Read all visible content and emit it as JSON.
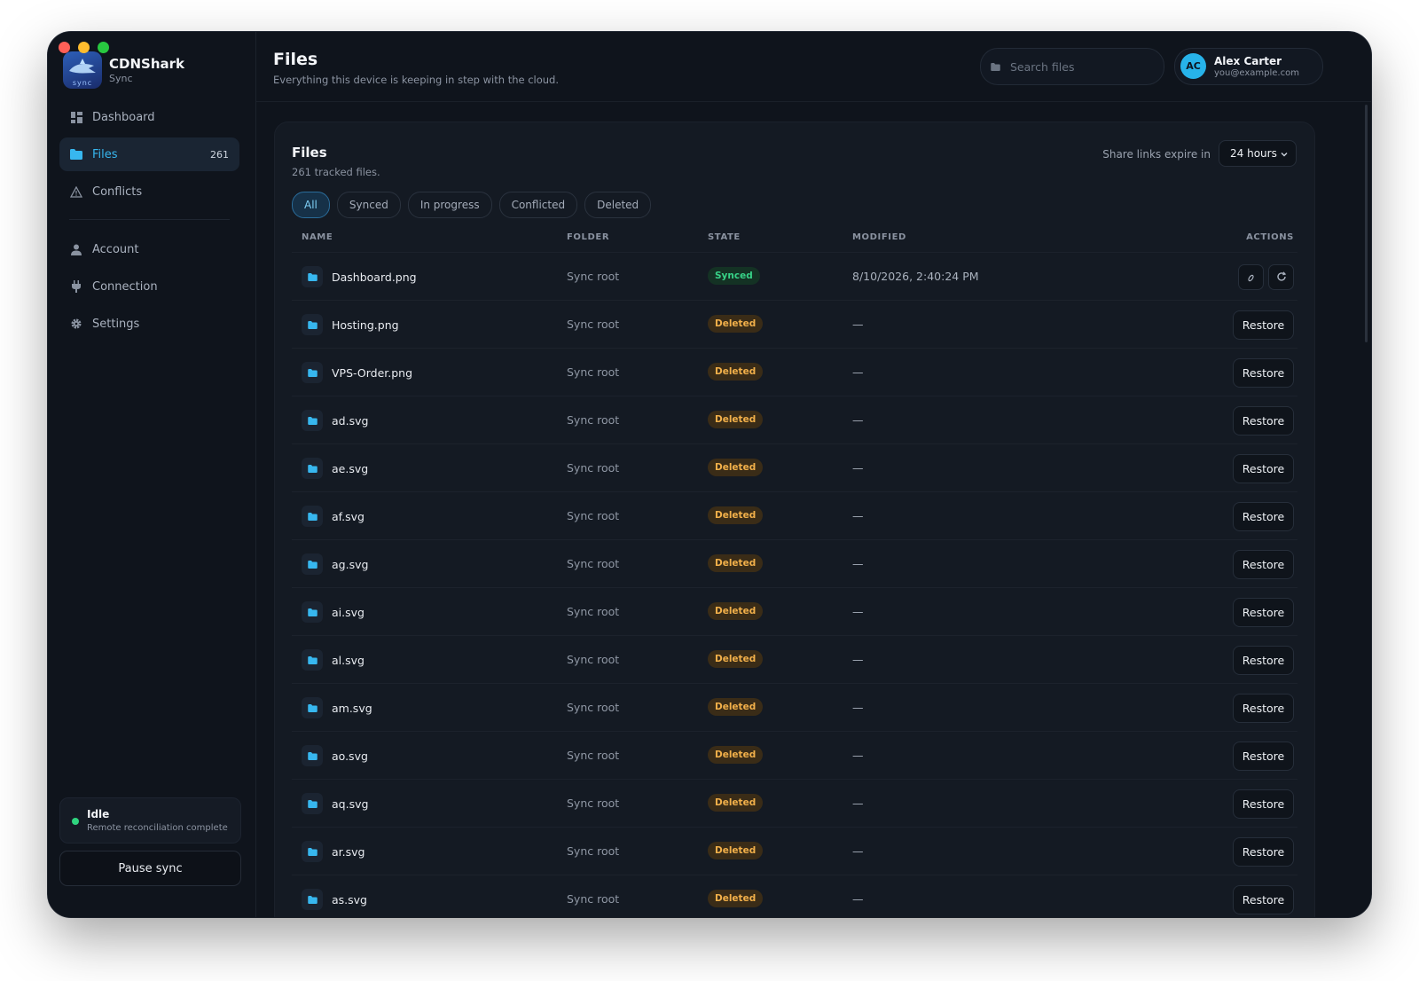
{
  "app": {
    "name": "CDNShark",
    "sub": "Sync",
    "logo_text": "sync"
  },
  "sidebar": {
    "items": [
      {
        "label": "Dashboard",
        "icon": "grid-icon"
      },
      {
        "label": "Files",
        "icon": "folder-icon",
        "count": "261",
        "active": true
      },
      {
        "label": "Conflicts",
        "icon": "warning-icon"
      },
      {
        "label": "Account",
        "icon": "user-icon"
      },
      {
        "label": "Connection",
        "icon": "plug-icon"
      },
      {
        "label": "Settings",
        "icon": "gear-icon"
      }
    ],
    "status": {
      "title": "Idle",
      "subtitle": "Remote reconciliation complete",
      "color": "#2fd47f"
    },
    "pause_label": "Pause sync"
  },
  "header": {
    "title": "Files",
    "subtitle": "Everything this device is keeping in step with the cloud.",
    "search_placeholder": "Search files",
    "user": {
      "initials": "AC",
      "name": "Alex Carter",
      "email": "you@example.com"
    }
  },
  "card": {
    "title": "Files",
    "subtitle": "261 tracked files.",
    "expire_label": "Share links expire in",
    "expire_value": "24 hours",
    "filters": [
      "All",
      "Synced",
      "In progress",
      "Conflicted",
      "Deleted"
    ],
    "active_filter": "All",
    "columns": {
      "name": "NAME",
      "folder": "FOLDER",
      "state": "STATE",
      "modified": "MODIFIED",
      "actions": "ACTIONS"
    },
    "restore_label": "Restore",
    "rows": [
      {
        "name": "Dashboard.png",
        "folder": "Sync root",
        "state": "Synced",
        "modified": "8/10/2026, 2:40:24 PM"
      },
      {
        "name": "Hosting.png",
        "folder": "Sync root",
        "state": "Deleted",
        "modified": "—"
      },
      {
        "name": "VPS-Order.png",
        "folder": "Sync root",
        "state": "Deleted",
        "modified": "—"
      },
      {
        "name": "ad.svg",
        "folder": "Sync root",
        "state": "Deleted",
        "modified": "—"
      },
      {
        "name": "ae.svg",
        "folder": "Sync root",
        "state": "Deleted",
        "modified": "—"
      },
      {
        "name": "af.svg",
        "folder": "Sync root",
        "state": "Deleted",
        "modified": "—"
      },
      {
        "name": "ag.svg",
        "folder": "Sync root",
        "state": "Deleted",
        "modified": "—"
      },
      {
        "name": "ai.svg",
        "folder": "Sync root",
        "state": "Deleted",
        "modified": "—"
      },
      {
        "name": "al.svg",
        "folder": "Sync root",
        "state": "Deleted",
        "modified": "—"
      },
      {
        "name": "am.svg",
        "folder": "Sync root",
        "state": "Deleted",
        "modified": "—"
      },
      {
        "name": "ao.svg",
        "folder": "Sync root",
        "state": "Deleted",
        "modified": "—"
      },
      {
        "name": "aq.svg",
        "folder": "Sync root",
        "state": "Deleted",
        "modified": "—"
      },
      {
        "name": "ar.svg",
        "folder": "Sync root",
        "state": "Deleted",
        "modified": "—"
      },
      {
        "name": "as.svg",
        "folder": "Sync root",
        "state": "Deleted",
        "modified": "—"
      }
    ]
  },
  "colors": {
    "accent": "#37b7ef",
    "deleted": "#f2b04a",
    "synced": "#37d287",
    "background": "#0f141c"
  }
}
